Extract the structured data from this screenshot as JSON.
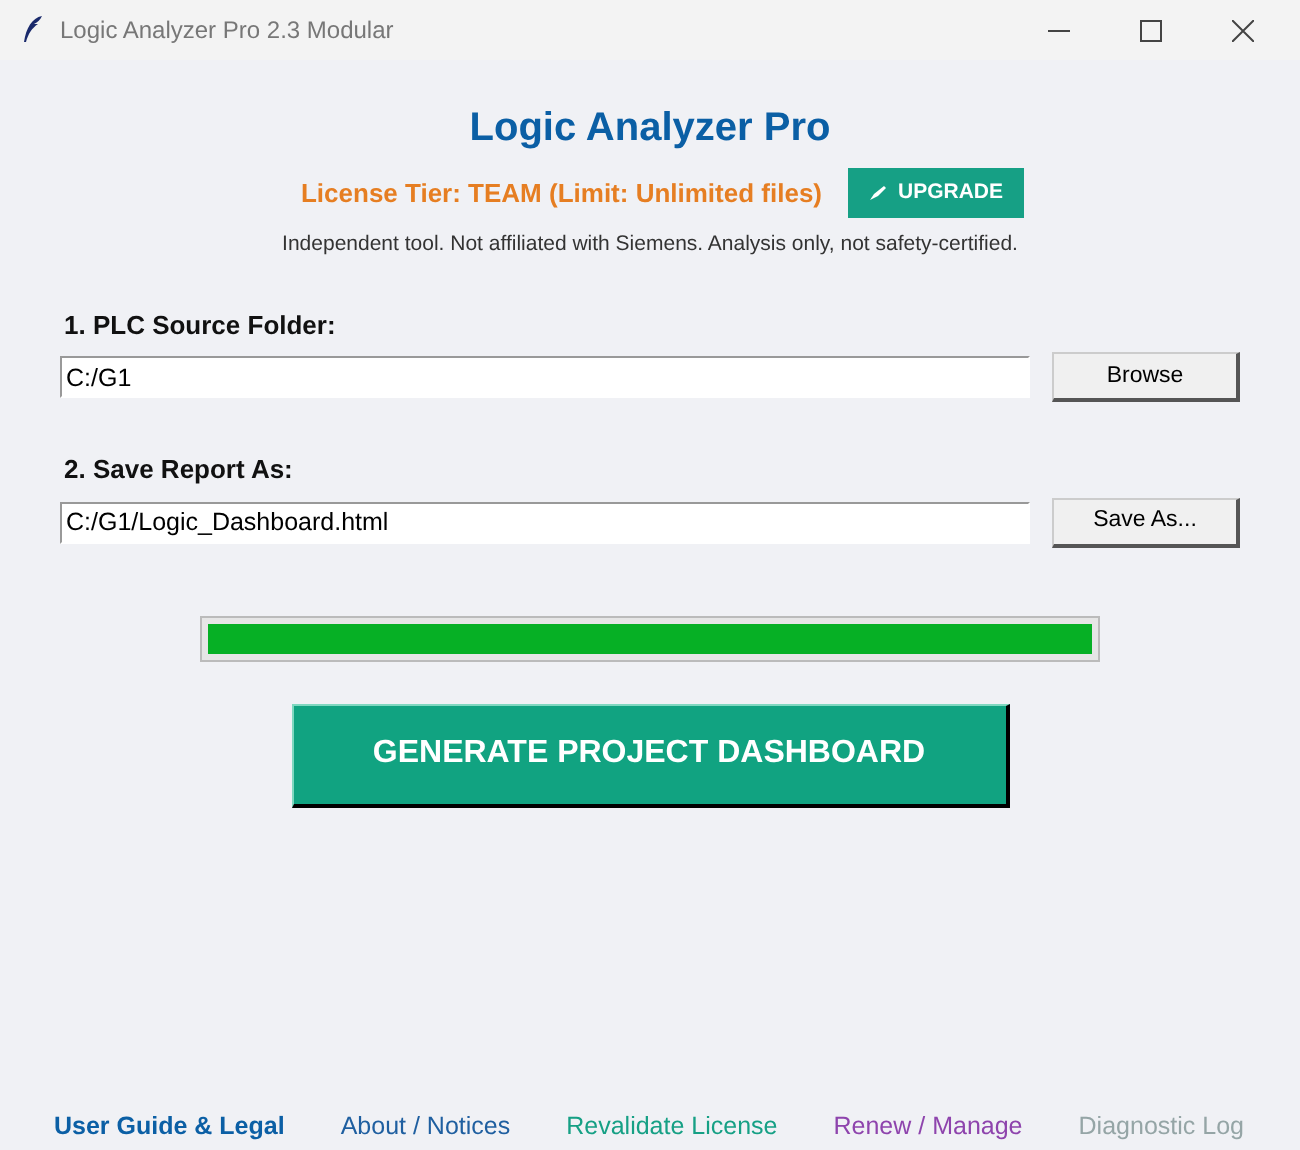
{
  "window": {
    "title": "Logic Analyzer Pro 2.3 Modular"
  },
  "header": {
    "title": "Logic Analyzer Pro",
    "license": "License Tier: TEAM (Limit: Unlimited files)",
    "upgrade_button": "UPGRADE",
    "disclaimer": "Independent tool. Not affiliated with Siemens. Analysis only, not safety-certified."
  },
  "fields": [
    {
      "label": "1. PLC Source Folder:",
      "value": "C:/G1",
      "button": "Browse"
    },
    {
      "label": "2. Save Report As:",
      "value": "C:/G1/Logic_Dashboard.html",
      "button": "Save As..."
    }
  ],
  "progress": {
    "level": 1
  },
  "generate_button": "GENERATE PROJECT DASHBOARD",
  "footer_links": [
    {
      "label": "User Guide & Legal",
      "color": "#0b5fa5",
      "bold": true
    },
    {
      "label": "About / Notices",
      "color": "#1f5fa0",
      "bold": false
    },
    {
      "label": "Revalidate License",
      "color": "#16a085",
      "bold": false
    },
    {
      "label": "Renew / Manage",
      "color": "#8e44ad",
      "bold": false
    },
    {
      "label": "Diagnostic Log",
      "color": "#95a5a6",
      "bold": false
    }
  ]
}
